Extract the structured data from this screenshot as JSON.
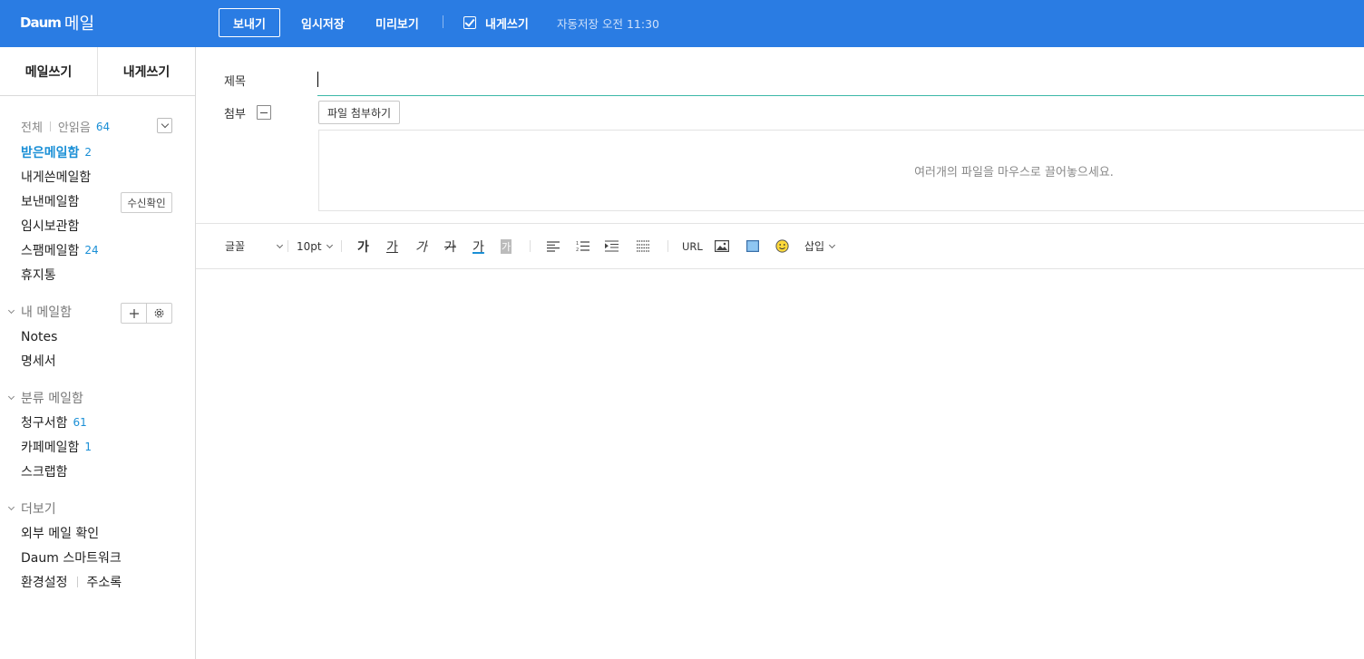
{
  "header": {
    "logo_brand": "Daum",
    "logo_service": "메일",
    "send_label": "보내기",
    "save_draft_label": "임시저장",
    "preview_label": "미리보기",
    "write_to_me_label": "내게쓰기",
    "autosave_text": "자동저장 오전 11:30",
    "accent_color": "#2a7ce3"
  },
  "sidebar": {
    "tabs": [
      "메일쓰기",
      "내게쓰기"
    ],
    "all_label": "전체",
    "unread_label": "안읽음",
    "unread_count": "64",
    "mailboxes": [
      {
        "label": "받은메일함",
        "count": "2"
      },
      {
        "label": "내게쓴메일함",
        "count": ""
      },
      {
        "label": "보낸메일함",
        "count": ""
      },
      {
        "label": "임시보관함",
        "count": ""
      },
      {
        "label": "스팸메일함",
        "count": "24"
      },
      {
        "label": "휴지통",
        "count": ""
      }
    ],
    "read_receipt_label": "수신확인",
    "my_mailbox_section": "내 메일함",
    "my_mailboxes": [
      "Notes",
      "명세서"
    ],
    "category_section": "분류 메일함",
    "categories": [
      {
        "label": "청구서함",
        "count": "61"
      },
      {
        "label": "카페메일함",
        "count": "1"
      },
      {
        "label": "스크랩함",
        "count": ""
      }
    ],
    "more_section": "더보기",
    "more_items": [
      "외부 메일 확인",
      "Daum 스마트워크"
    ],
    "settings_label": "환경설정",
    "address_book_label": "주소록"
  },
  "compose": {
    "subject_label": "제목",
    "subject_value": "",
    "attach_label": "첨부",
    "attach_button": "파일 첨부하기",
    "dropzone_text": "여러개의 파일을 마우스로 끌어놓으세요."
  },
  "toolbar": {
    "font_label": "글꼴",
    "size_label": "10pt",
    "bold_glyph": "가",
    "underline_glyph": "가",
    "italic_glyph": "가",
    "strike_glyph": "가",
    "fontcolor_glyph": "가",
    "bgcolor_glyph": "가",
    "url_label": "URL",
    "insert_label": "삽입"
  }
}
